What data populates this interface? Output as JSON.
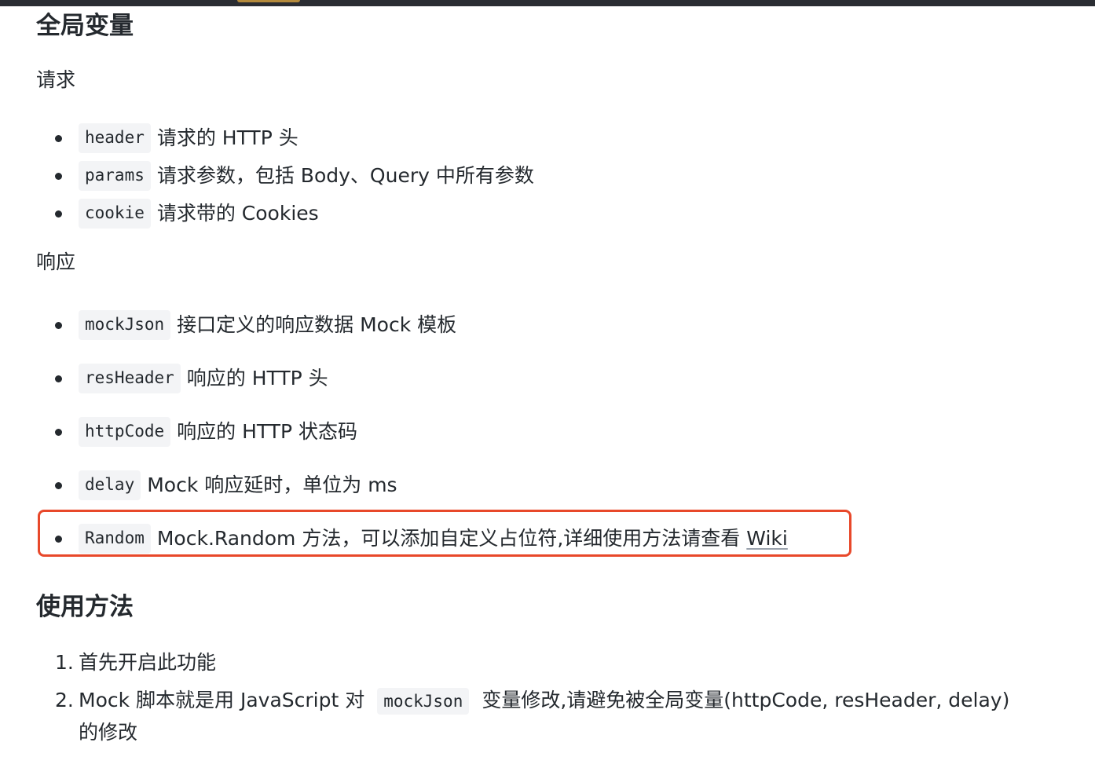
{
  "headings": {
    "globals": "全局变量",
    "usage": "使用方法"
  },
  "request": {
    "label": "请求",
    "items": [
      {
        "code": "header",
        "text": "请求的 HTTP 头"
      },
      {
        "code": "params",
        "text": "请求参数，包括 Body、Query 中所有参数"
      },
      {
        "code": "cookie",
        "text": "请求带的 Cookies"
      }
    ]
  },
  "response": {
    "label": "响应",
    "items": [
      {
        "code": "mockJson",
        "text": "接口定义的响应数据 Mock 模板"
      },
      {
        "code": "resHeader",
        "text": "响应的 HTTP 头"
      },
      {
        "code": "httpCode",
        "text": "响应的 HTTP 状态码"
      },
      {
        "code": "delay",
        "text": "Mock 响应延时，单位为 ms"
      },
      {
        "code": "Random",
        "text": "Mock.Random 方法，可以添加自定义占位符,详细使用方法请查看",
        "link": "Wiki"
      }
    ]
  },
  "usage": {
    "steps": [
      {
        "num": "1.",
        "text": "首先开启此功能"
      },
      {
        "num": "2.",
        "text_before": "Mock 脚本就是用 JavaScript 对",
        "code": "mockJson",
        "text_after": "变量修改,请避免被全局变量(httpCode, resHeader, delay)",
        "text_wrap": "的修改"
      }
    ]
  },
  "colors": {
    "highlight_border": "#e8482a",
    "code_bg": "#f3f4f6",
    "text": "#24292e"
  }
}
